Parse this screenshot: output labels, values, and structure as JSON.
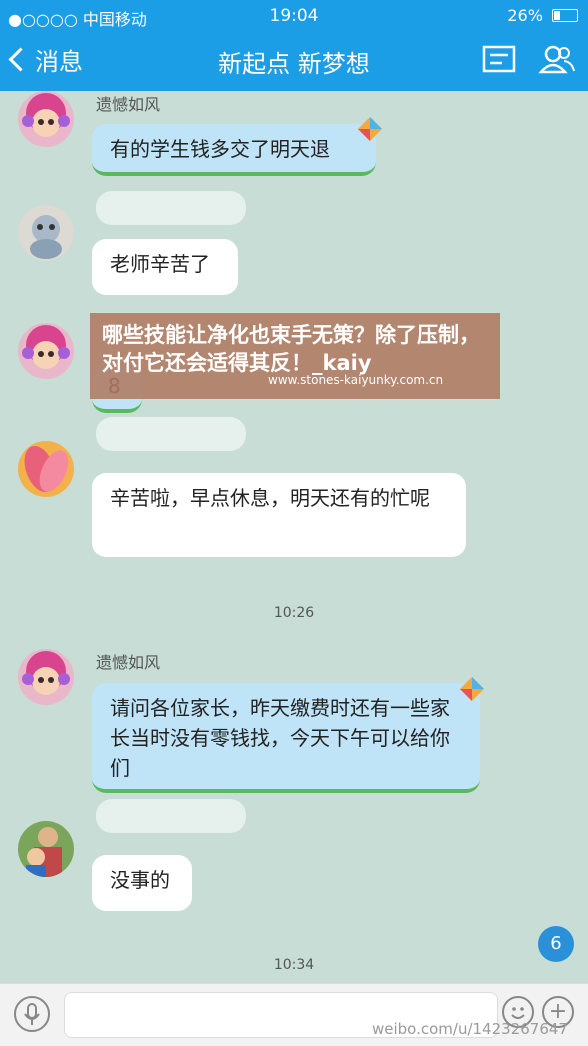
{
  "status": {
    "carrier": "●○○○○ 中国移动",
    "time": "19:04",
    "battery": "26%"
  },
  "nav": {
    "back_label": "消息",
    "title": "新起点 新梦想"
  },
  "messages": [
    {
      "sender": "遗憾如风",
      "text": "有的学生钱多交了明天退"
    },
    {
      "text": "老师辛苦了"
    },
    {
      "text": "8"
    },
    {
      "text": "辛苦啦，早点休息，明天还有的忙呢"
    },
    {
      "sender": "遗憾如风",
      "text": "请问各位家长，昨天缴费时还有一些家长当时没有零钱找，今天下午可以给你们"
    },
    {
      "text": "没事的"
    }
  ],
  "timestamps": [
    "10:26",
    "10:34"
  ],
  "banner": {
    "headline": "哪些技能让净化也束手无策？除了压制，对付它还会适得其反！_kaiy",
    "url": "www.stones-kaiyunky.com.cn"
  },
  "badge": "6",
  "watermark": "weibo.com/u/1423267647",
  "colors": {
    "header": "#1c9ee6",
    "chat_bg": "#c7ddd6",
    "sent_bubble": "#bfe3f7"
  }
}
